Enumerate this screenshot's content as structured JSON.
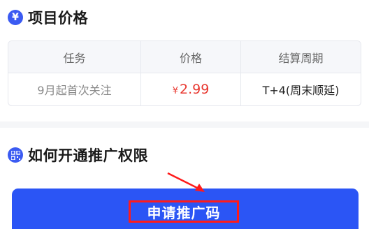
{
  "section_price": {
    "icon": "yen-icon",
    "icon_glyph": "¥",
    "title": "项目价格"
  },
  "table": {
    "headers": [
      "任务",
      "价格",
      "结算周期"
    ],
    "row": {
      "task": "9月起首次关注",
      "price_symbol": "¥",
      "price_value": "2.99",
      "settlement": "T+4(周末顺延)"
    }
  },
  "section_permission": {
    "icon": "qrcode-icon",
    "title": "如何开通推广权限"
  },
  "apply_button": {
    "label": "申请推广码"
  },
  "colors": {
    "accent": "#2b55f5",
    "price": "#e8372f",
    "highlight": "#ff1b1b"
  }
}
